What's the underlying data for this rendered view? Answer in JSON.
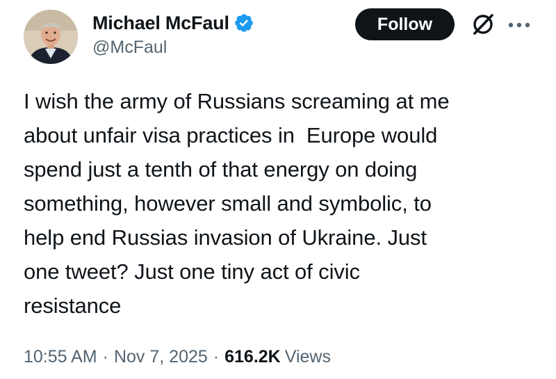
{
  "author": {
    "display_name": "Michael McFaul",
    "handle": "@McFaul",
    "verified_color": "#1d9bf0",
    "avatar_icon": "profile-photo"
  },
  "actions": {
    "follow_label": "Follow",
    "grok_icon": "grok-icon",
    "more_icon": "more-horizontal-icon"
  },
  "tweet": {
    "text": "I wish the army of Russians screaming at me\nabout unfair visa practices in  Europe would\nspend just a tenth of that energy on doing\nsomething, however small and symbolic, to\nhelp end Russias invasion of Ukraine. Just\none tweet? Just one tiny act of civic\nresistance"
  },
  "meta": {
    "time": "10:55 AM",
    "separator": "·",
    "date": "Nov 7, 2025",
    "views_count": "616.2K",
    "views_label": "Views"
  },
  "colors": {
    "text_primary": "#0f1419",
    "text_secondary": "#536471",
    "button_bg": "#0f1419",
    "button_text": "#ffffff"
  }
}
